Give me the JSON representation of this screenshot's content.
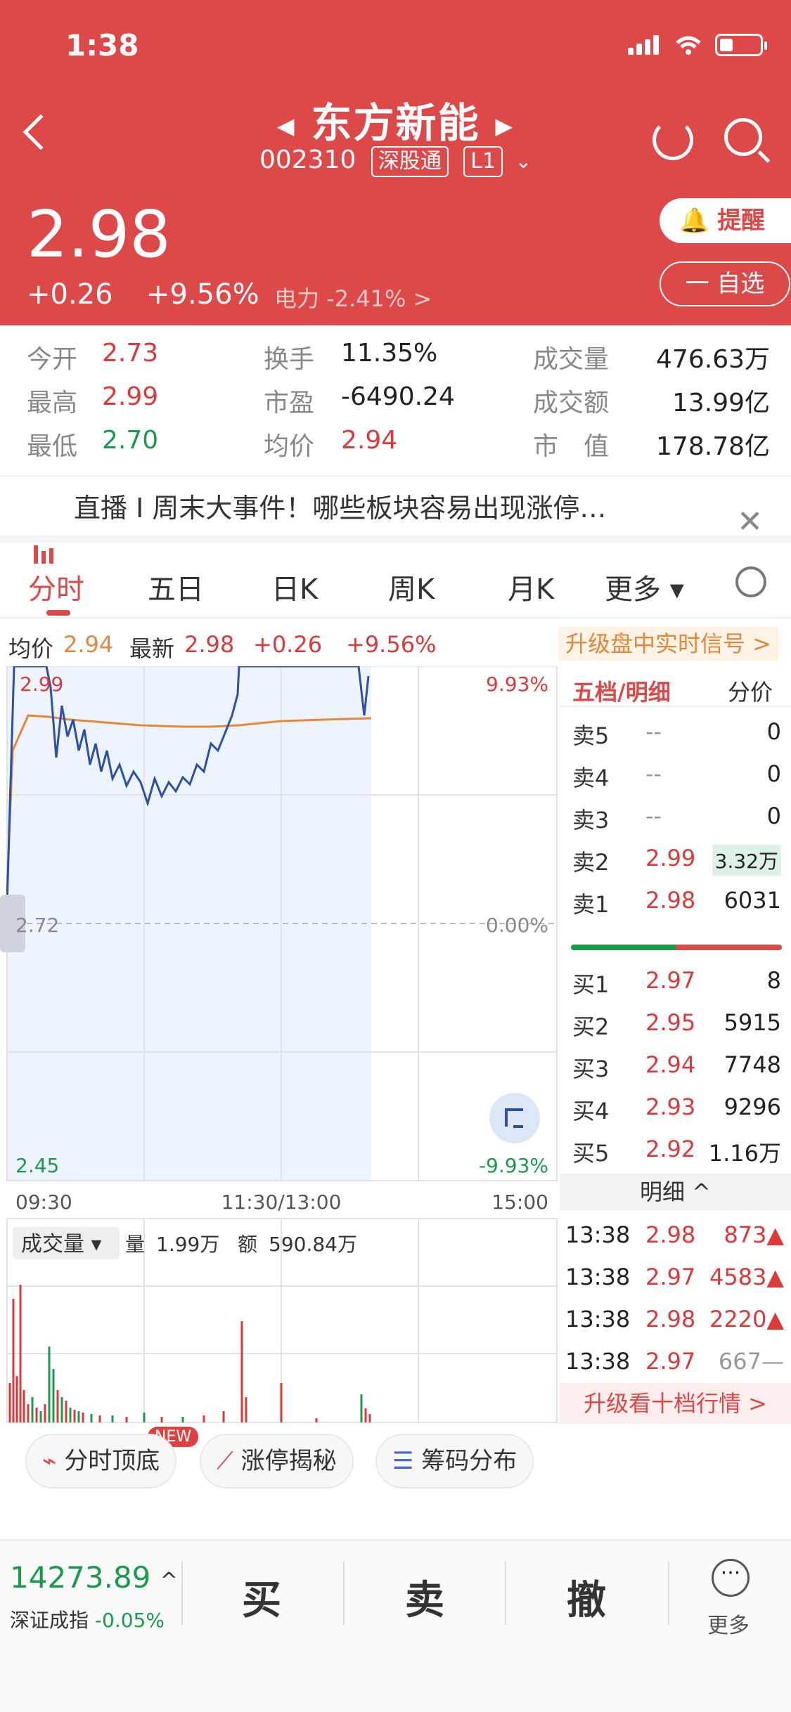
{
  "status": {
    "time": "1:38"
  },
  "header": {
    "title": "东方新能",
    "code": "002310",
    "tag1": "深股通",
    "tag2": "L1",
    "price": "2.98",
    "change": "+0.26",
    "change_pct": "+9.56%",
    "sector": "电力 -2.41% >",
    "remind": "提醒",
    "watch": "一 自选"
  },
  "stats": {
    "open_l": "今开",
    "open_v": "2.73",
    "high_l": "最高",
    "high_v": "2.99",
    "low_l": "最低",
    "low_v": "2.70",
    "turn_l": "换手",
    "turn_v": "11.35%",
    "pe_l": "市盈",
    "pe_v": "-6490.24",
    "avg_l": "均价",
    "avg_v": "2.94",
    "vol_l": "成交量",
    "vol_v": "476.63万",
    "amt_l": "成交额",
    "amt_v": "13.99亿",
    "cap_l": "市　值",
    "cap_v": "178.78亿"
  },
  "live": {
    "text": "直播 I 周末大事件！哪些板块容易出现涨停…"
  },
  "tabs": [
    "分时",
    "五日",
    "日K",
    "周K",
    "月K",
    "更多 ▾"
  ],
  "infobar": {
    "avg_l": "均价",
    "avg_v": "2.94",
    "last_l": "最新",
    "last_v": "2.98",
    "chg": "+0.26",
    "pct": "+9.56%",
    "upgrade": "升级盘中实时信号 >"
  },
  "chart": {
    "ymax_label": "2.99",
    "ymax_pct": "9.93%",
    "mid_label": "2.72",
    "mid_pct": "0.00%",
    "ymin_label": "2.45",
    "ymin_pct": "-9.93%",
    "t0": "09:30",
    "t1": "11:30/13:00",
    "t2": "15:00",
    "vol_btn": "成交量 ▾",
    "vol_l": "量",
    "vol_v": "1.99万",
    "amt_l": "额",
    "amt_v": "590.84万"
  },
  "orderbook": {
    "header_a": "五档/明细",
    "header_b": "分价",
    "asks": [
      {
        "l": "卖5",
        "p": "--",
        "v": "0"
      },
      {
        "l": "卖4",
        "p": "--",
        "v": "0"
      },
      {
        "l": "卖3",
        "p": "--",
        "v": "0"
      },
      {
        "l": "卖2",
        "p": "2.99",
        "v": "3.32万"
      },
      {
        "l": "卖1",
        "p": "2.98",
        "v": "6031"
      }
    ],
    "bids": [
      {
        "l": "买1",
        "p": "2.97",
        "v": "8"
      },
      {
        "l": "买2",
        "p": "2.95",
        "v": "5915"
      },
      {
        "l": "买3",
        "p": "2.94",
        "v": "7748"
      },
      {
        "l": "买4",
        "p": "2.93",
        "v": "9296"
      },
      {
        "l": "买5",
        "p": "2.92",
        "v": "1.16万"
      }
    ],
    "detail_label": "明细 ^",
    "ticks": [
      {
        "t": "13:38",
        "p": "2.98",
        "v": "873▲"
      },
      {
        "t": "13:38",
        "p": "2.97",
        "v": "4583▲"
      },
      {
        "t": "13:38",
        "p": "2.98",
        "v": "2220▲"
      },
      {
        "t": "13:38",
        "p": "2.97",
        "v": "667—"
      }
    ],
    "upgrade": "升级看十档行情 >"
  },
  "tools": {
    "t1": "分时顶底",
    "t2": "涨停揭秘",
    "t3": "筹码分布",
    "new": "NEW"
  },
  "bottom": {
    "idx_val": "14273.89",
    "idx_name": "深证成指",
    "idx_pct": "-0.05%",
    "buy": "买",
    "sell": "卖",
    "cancel": "撤",
    "more": "更多"
  },
  "colors": {
    "red": "#dd4848",
    "green": "#1a9a4c",
    "blue": "#2c4fa8",
    "orange": "#e6863a"
  }
}
